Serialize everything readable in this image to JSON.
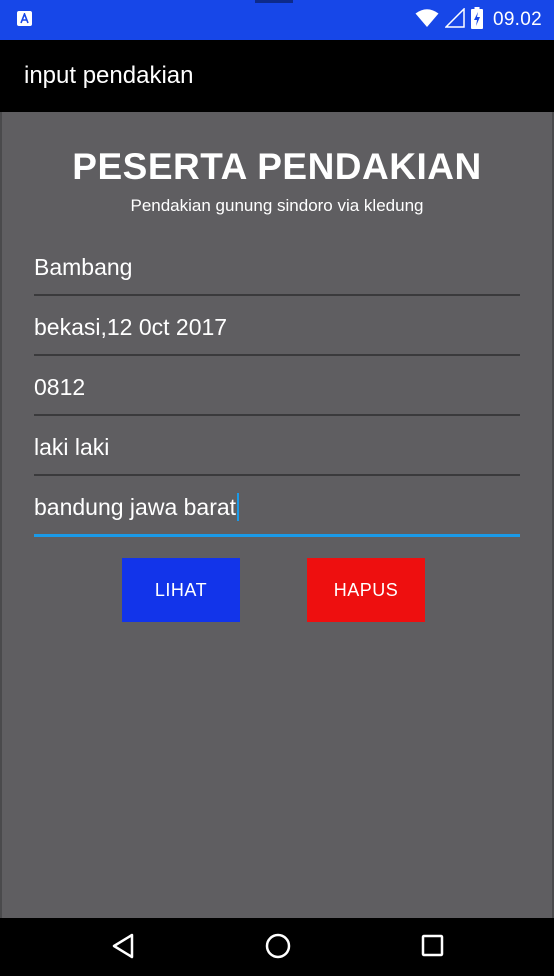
{
  "status_bar": {
    "time": "09.02",
    "icons": [
      "notification-a-icon",
      "wifi-icon",
      "cell-signal-icon",
      "battery-charging-icon"
    ],
    "color": "#1747e8"
  },
  "app_bar": {
    "title": "input pendakian"
  },
  "form": {
    "heading": "PESERTA PENDAKIAN",
    "subheading": "Pendakian gunung sindoro via kledung",
    "fields": [
      {
        "value": "Bambang"
      },
      {
        "value": "bekasi,12 0ct 2017"
      },
      {
        "value": "0812"
      },
      {
        "value": "laki laki"
      },
      {
        "value": "bandung jawa barat"
      }
    ]
  },
  "buttons": {
    "lihat": {
      "label": "LIHAT",
      "color": "#1234ea"
    },
    "hapus": {
      "label": "HAPUS",
      "color": "#ee0f0f"
    }
  },
  "nav_bar": {
    "icons": [
      "back-icon",
      "home-icon",
      "recents-icon"
    ]
  }
}
